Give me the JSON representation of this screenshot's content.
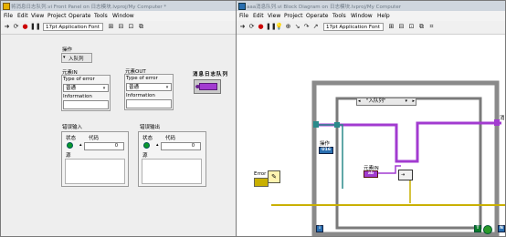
{
  "front_panel": {
    "title": "将消息日志队列.vi Front Panel on 日志模块.lvproj/My Computer *",
    "menu": [
      "File",
      "Edit",
      "View",
      "Project",
      "Operate",
      "Tools",
      "Window"
    ],
    "font_label": "17pt Application Font",
    "operation_label": "操作",
    "operation_value": "入队列",
    "element_in": {
      "label": "元素IN",
      "field_label": "Type of error",
      "type_value": "普通",
      "info_label": "Information"
    },
    "element_out": {
      "label": "元素OUT",
      "field_label": "Type of error",
      "type_value": "普通",
      "info_label": "Information"
    },
    "queue_label": "消息日志队列",
    "error_in": {
      "label": "错误输入",
      "status_label": "状态",
      "code_label": "代码",
      "code_value": "0",
      "source_label": "源"
    },
    "error_out": {
      "label": "错误输出",
      "status_label": "状态",
      "code_label": "代码",
      "code_value": "0",
      "source_label": "源"
    }
  },
  "block_diagram": {
    "title": "aaa消息队列.vi Block Diagram on 日志模块.lvproj/My Computer",
    "menu": [
      "File",
      "Edit",
      "View",
      "Project",
      "Operate",
      "Tools",
      "Window",
      "Help"
    ],
    "font_label": "17pt Application Font",
    "case_selector": "\"入队列\"",
    "operation_terminal_label": "操作",
    "element_terminal_label": "元素IN",
    "error_label": "Error",
    "iteration_label": "i",
    "condition_label": "T",
    "loop_count_label": "N",
    "right_edge_label": "消"
  },
  "colors": {
    "wire_purple": "#a23bd0",
    "wire_green": "#2a8a8a",
    "wire_error": "#c9b000",
    "loop_border": "#8a8a8a"
  }
}
